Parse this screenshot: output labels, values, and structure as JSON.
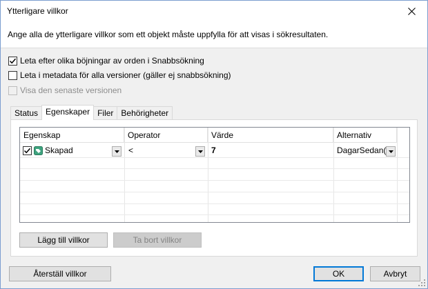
{
  "window": {
    "title": "Ytterligare villkor"
  },
  "header": {
    "text": "Ange alla de ytterligare villkor som ett objekt måste uppfylla för att visas i sökresultaten."
  },
  "options": [
    {
      "label": "Leta efter olika böjningar av orden i Snabbsökning",
      "checked": true,
      "enabled": true
    },
    {
      "label": "Leta i metadata för alla versioner (gäller ej snabbsökning)",
      "checked": false,
      "enabled": true
    },
    {
      "label": "Visa den senaste versionen",
      "checked": false,
      "enabled": false
    }
  ],
  "tabs": [
    {
      "label": "Status",
      "active": false
    },
    {
      "label": "Egenskaper",
      "active": true
    },
    {
      "label": "Filer",
      "active": false
    },
    {
      "label": "Behörigheter",
      "active": false
    }
  ],
  "grid": {
    "columns": [
      "Egenskap",
      "Operator",
      "Värde",
      "Alternativ"
    ],
    "rows": [
      {
        "checked": true,
        "property": "Skapad",
        "operator": "<",
        "value": "7",
        "alternative": "DagarSedan()"
      }
    ]
  },
  "buttons": {
    "add": "Lägg till villkor",
    "remove": "Ta bort villkor",
    "reset": "Återställ villkor",
    "ok": "OK",
    "cancel": "Avbryt"
  }
}
